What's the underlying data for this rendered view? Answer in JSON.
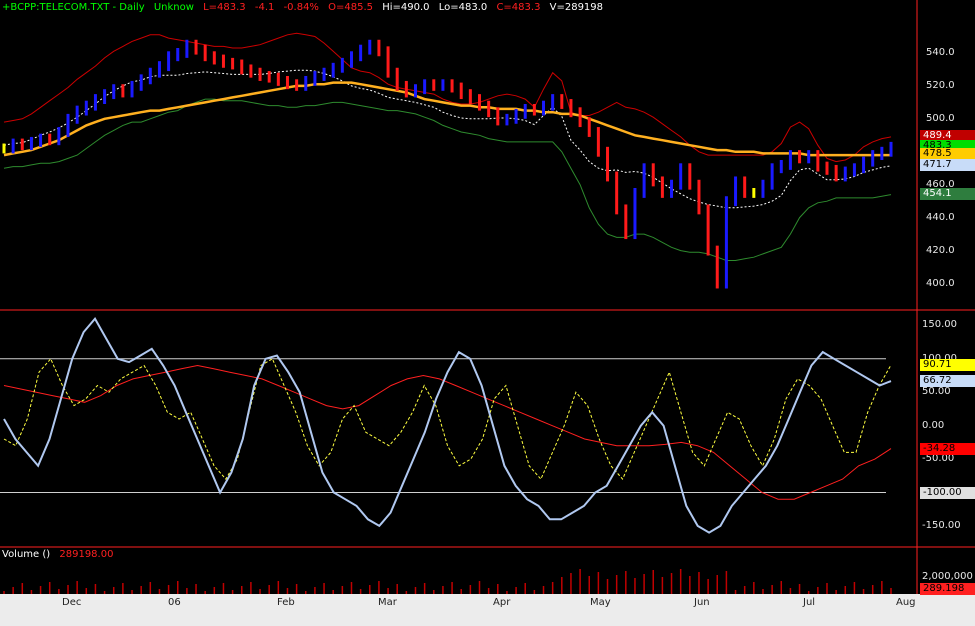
{
  "header": {
    "ticker": "+BCPP:TELECOM.TXT - Daily",
    "mode": "Unknow",
    "last": "L=483.3",
    "change": "-4.1",
    "change_pct": "-0.84%",
    "open": "O=485.5",
    "high": "Hi=490.0",
    "low": "Lo=483.0",
    "close": "C=483.3",
    "volume": "V=289198"
  },
  "colors": {
    "up_bar": "#1a1aff",
    "down_bar": "#ff1a1a",
    "neutral_bar": "#ffff00",
    "ma_long": "#ffb020",
    "band_upper": "#cc0000",
    "band_lower": "#2e8b2e",
    "band_mid": "#ffffff",
    "cci_fast": "#b0c8f0",
    "cci_slow": "#ffff40",
    "cci_signal": "#ff2020",
    "separator": "#ff2020"
  },
  "price_axis": {
    "ticks": [
      "540.0",
      "520.0",
      "500.0",
      "480.0",
      "460.0",
      "440.0",
      "420.0",
      "400.0"
    ],
    "tags": [
      {
        "text": "489.4",
        "bg": "#c00000",
        "fg": "#ffffff",
        "value": 489.4
      },
      {
        "text": "483.3",
        "bg": "#00dd00",
        "fg": "#000000",
        "value": 483.3
      },
      {
        "text": "478.5",
        "bg": "#ffcc00",
        "fg": "#000000",
        "value": 478.5
      },
      {
        "text": "471.7",
        "bg": "#c8dcf8",
        "fg": "#000000",
        "value": 471.7
      },
      {
        "text": "454.1",
        "bg": "#2e7d3e",
        "fg": "#ffffff",
        "value": 454.1
      }
    ]
  },
  "osc_axis": {
    "ticks": [
      "150.00",
      "100.00",
      "50.00",
      "0.00",
      "-50.00",
      "-100.00",
      "-150.00"
    ],
    "tags": [
      {
        "text": "90.71",
        "bg": "#ffff00",
        "fg": "#000000",
        "value": 90.71
      },
      {
        "text": "66.72",
        "bg": "#c8dcf8",
        "fg": "#000000",
        "value": 66.72
      },
      {
        "text": "-34.28",
        "bg": "#ff0000",
        "fg": "#000000",
        "value": -34.28
      },
      {
        "text": "-100.00",
        "bg": "#e0e0e0",
        "fg": "#000000",
        "value": -100.0
      }
    ]
  },
  "volume_panel": {
    "label": "Volume  ()",
    "value": "289198.00",
    "axis_tick": "2,000,000",
    "tag": "289.198"
  },
  "date_axis": [
    "Dec",
    "06",
    "Feb",
    "Mar",
    "Apr",
    "May",
    "Jun",
    "Jul",
    "Aug"
  ],
  "chart_data": {
    "type": "line",
    "price_series": {
      "close": [
        482,
        485,
        484,
        486,
        488,
        487,
        492,
        500,
        505,
        508,
        512,
        515,
        518,
        516,
        520,
        524,
        528,
        532,
        538,
        540,
        545,
        542,
        538,
        536,
        534,
        533,
        530,
        528,
        526,
        525,
        523,
        521,
        520,
        523,
        526,
        528,
        531,
        534,
        538,
        542,
        545,
        541,
        528,
        520,
        516,
        518,
        521,
        520,
        521,
        519,
        515,
        512,
        508,
        504,
        499,
        500,
        503,
        506,
        505,
        508,
        512,
        509,
        504,
        498,
        492,
        480,
        465,
        445,
        430,
        455,
        470,
        462,
        455,
        460,
        470,
        460,
        445,
        420,
        400,
        450,
        462,
        455,
        455,
        460,
        470,
        472,
        478,
        476,
        478,
        471,
        469,
        465,
        468,
        470,
        474,
        478,
        480,
        483
      ]
    },
    "bands": {
      "ma_long": [
        478,
        479,
        480,
        481,
        483,
        485,
        487,
        490,
        493,
        496,
        498,
        500,
        501,
        502,
        503,
        504,
        505,
        505,
        506,
        507,
        508,
        509,
        510,
        511,
        512,
        513,
        514,
        515,
        516,
        517,
        518,
        519,
        520,
        520,
        521,
        521,
        522,
        522,
        522,
        521,
        520,
        519,
        518,
        517,
        516,
        514,
        512,
        511,
        510,
        509,
        508,
        508,
        507,
        507,
        506,
        506,
        506,
        505,
        505,
        504,
        504,
        503,
        503,
        502,
        500,
        498,
        496,
        494,
        492,
        490,
        489,
        488,
        487,
        486,
        485,
        484,
        483,
        482,
        481,
        481,
        480,
        480,
        480,
        479,
        479,
        479,
        479,
        479,
        478,
        478,
        478,
        478,
        478,
        478,
        478,
        478,
        478,
        478
      ],
      "upper": [
        498,
        499,
        500,
        503,
        507,
        511,
        515,
        519,
        524,
        528,
        532,
        537,
        541,
        544,
        547,
        549,
        551,
        551,
        549,
        548,
        547,
        546,
        545,
        544,
        544,
        543,
        543,
        544,
        545,
        547,
        549,
        551,
        552,
        551,
        550,
        546,
        541,
        536,
        531,
        529,
        528,
        525,
        521,
        519,
        518,
        517,
        516,
        515,
        512,
        510,
        509,
        509,
        510,
        512,
        514,
        515,
        514,
        512,
        507,
        518,
        528,
        523,
        504,
        502,
        502,
        504,
        507,
        510,
        507,
        506,
        504,
        501,
        497,
        493,
        489,
        484,
        480,
        478,
        478,
        478,
        478,
        478,
        478,
        478,
        480,
        485,
        495,
        498,
        494,
        484,
        476,
        474,
        475,
        478,
        483,
        486,
        488,
        489
      ],
      "lower": [
        470,
        471,
        471,
        472,
        473,
        473,
        474,
        476,
        478,
        482,
        486,
        490,
        493,
        496,
        498,
        498,
        500,
        502,
        504,
        505,
        508,
        510,
        512,
        512,
        511,
        511,
        511,
        510,
        509,
        508,
        508,
        507,
        507,
        508,
        508,
        509,
        510,
        510,
        509,
        508,
        507,
        506,
        505,
        505,
        504,
        503,
        501,
        499,
        496,
        494,
        492,
        491,
        490,
        488,
        487,
        486,
        486,
        486,
        486,
        486,
        486,
        480,
        470,
        460,
        446,
        436,
        430,
        428,
        428,
        430,
        430,
        428,
        425,
        422,
        420,
        419,
        419,
        418,
        416,
        414,
        414,
        415,
        416,
        418,
        420,
        422,
        430,
        440,
        446,
        449,
        450,
        452,
        452,
        452,
        452,
        452,
        453,
        454
      ]
    },
    "oscillator": {
      "cci_fast": [
        10,
        -20,
        -40,
        -60,
        -20,
        40,
        100,
        140,
        160,
        130,
        100,
        95,
        105,
        115,
        90,
        60,
        20,
        -20,
        -60,
        -100,
        -70,
        -20,
        60,
        100,
        105,
        80,
        50,
        -10,
        -70,
        -100,
        -110,
        -120,
        -140,
        -150,
        -130,
        -90,
        -50,
        -10,
        40,
        80,
        110,
        100,
        60,
        0,
        -60,
        -90,
        -110,
        -120,
        -140,
        -140,
        -130,
        -120,
        -100,
        -90,
        -60,
        -30,
        0,
        20,
        0,
        -60,
        -120,
        -150,
        -160,
        -150,
        -120,
        -100,
        -80,
        -60,
        -30,
        10,
        50,
        90,
        110,
        100,
        90,
        80,
        70,
        60,
        66.72
      ],
      "cci_slow": [
        -20,
        -30,
        10,
        80,
        100,
        60,
        30,
        40,
        60,
        50,
        70,
        80,
        90,
        60,
        20,
        10,
        20,
        -20,
        -60,
        -80,
        -50,
        20,
        90,
        100,
        60,
        20,
        -30,
        -60,
        -40,
        10,
        30,
        -10,
        -20,
        -30,
        -10,
        20,
        60,
        30,
        -30,
        -60,
        -50,
        -20,
        40,
        60,
        0,
        -60,
        -80,
        -40,
        0,
        50,
        30,
        -20,
        -60,
        -80,
        -40,
        0,
        40,
        80,
        20,
        -40,
        -60,
        -20,
        20,
        10,
        -30,
        -60,
        -20,
        40,
        70,
        60,
        40,
        0,
        -40,
        -40,
        20,
        60,
        90.71
      ],
      "signal": [
        60,
        55,
        50,
        45,
        40,
        35,
        45,
        60,
        70,
        75,
        80,
        85,
        90,
        85,
        80,
        75,
        70,
        60,
        50,
        40,
        30,
        25,
        30,
        45,
        60,
        70,
        75,
        70,
        60,
        50,
        40,
        30,
        20,
        10,
        0,
        -10,
        -20,
        -25,
        -30,
        -30,
        -30,
        -28,
        -25,
        -30,
        -40,
        -60,
        -80,
        -100,
        -110,
        -110,
        -100,
        -90,
        -80,
        -60,
        -50,
        -34.28
      ]
    },
    "ranges": {
      "price_ylim": [
        390,
        560
      ],
      "osc_ylim": [
        -180,
        170
      ]
    }
  }
}
